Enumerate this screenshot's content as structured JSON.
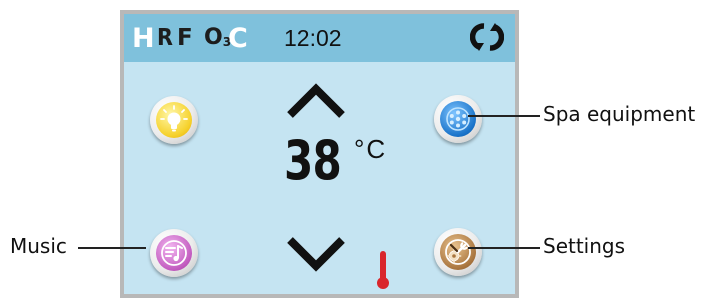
{
  "status_bar": {
    "indicator_h": "H",
    "indicator_r": "R",
    "indicator_f": "F",
    "indicator_o3": "O",
    "indicator_o3_sub": "3",
    "indicator_c": "C",
    "time": "12:02",
    "sync_icon": "sync-arrows-icon"
  },
  "temperature": {
    "value": "38",
    "unit": "°C",
    "up_icon": "chevron-up-icon",
    "down_icon": "chevron-down-icon",
    "thermometer_icon": "thermometer-icon"
  },
  "buttons": {
    "light_icon": "light-bulb-icon",
    "equipment_icon": "spa-jets-icon",
    "music_icon": "music-note-icon",
    "settings_icon": "wrench-gear-icon"
  },
  "callouts": {
    "spa_equipment": "Spa equipment",
    "music": "Music",
    "settings": "Settings"
  },
  "colors": {
    "screen_bg": "#c5e4f2",
    "status_bar_bg": "#7fc1dc",
    "light_accent": "#f6d22e",
    "equipment_accent": "#1a73c9",
    "music_accent": "#c25bbf",
    "settings_accent": "#a9753e",
    "thermometer": "#d9262c"
  }
}
